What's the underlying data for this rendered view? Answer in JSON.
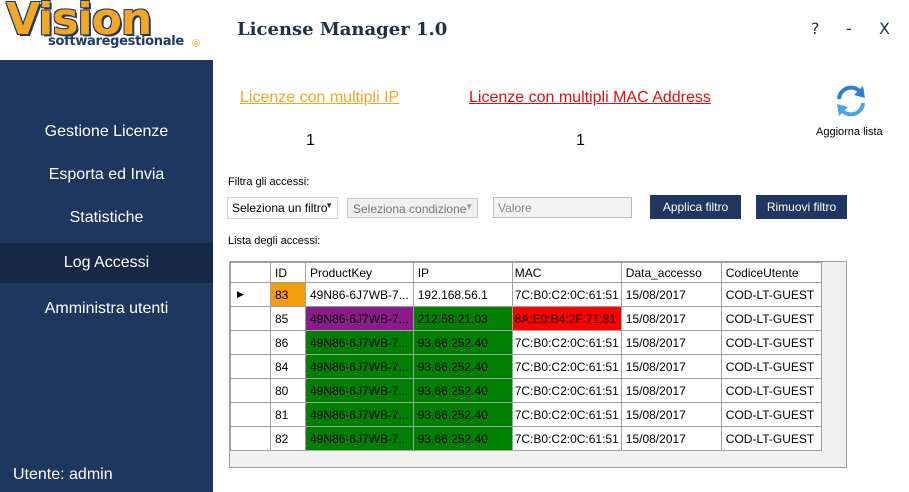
{
  "app": {
    "logo_main": "Vision",
    "logo_sub": "softwaregestionale",
    "logo_reg": "®",
    "title": "License Manager 1.0",
    "help_label": "?",
    "minimize_label": "-",
    "close_label": "X"
  },
  "sidebar": {
    "items": [
      {
        "label": "Gestione Licenze"
      },
      {
        "label": "Esporta ed Invia"
      },
      {
        "label": "Statistiche"
      },
      {
        "label": "Log Accessi"
      },
      {
        "label": "Amministra utenti"
      }
    ],
    "active_item": "Log Accessi",
    "user_label": "Utente:  admin"
  },
  "summary": {
    "multi_ip_link": "Licenze con multipli IP",
    "multi_ip_count": "1",
    "multi_mac_link": "Licenze con multipli MAC Address",
    "multi_mac_count": "1",
    "refresh_label": "Aggiorna lista",
    "refresh_icon": "refresh-arrows-icon"
  },
  "filter": {
    "label": "Filtra gli accessi:",
    "field_select": "Seleziona un filtro",
    "condition_select": "Seleziona condizione",
    "value_placeholder": "Valore",
    "apply_button": "Applica filtro",
    "remove_button": "Rimuovi filtro"
  },
  "grid": {
    "label": "Lista degli accessi:",
    "current_row_marker": "▶",
    "columns": [
      "ID",
      "ProductKey",
      "IP",
      "MAC",
      "Data_accesso",
      "CodiceUtente"
    ],
    "rows": [
      {
        "id": "83",
        "productkey": "49N86-6J7WB-7...",
        "ip": "192.168.56.1",
        "mac": "7C:B0:C2:0C:61:51",
        "date": "15/08/2017",
        "code": "COD-LT-GUEST"
      },
      {
        "id": "85",
        "productkey": "49N86-6J7WB-7...",
        "ip": "212.58.21.03",
        "mac": "8A:E0:B4:2F:71:81",
        "date": "15/08/2017",
        "code": "COD-LT-GUEST"
      },
      {
        "id": "86",
        "productkey": "49N86-6J7WB-7...",
        "ip": "93.66.252.40",
        "mac": "7C:B0:C2:0C:61:51",
        "date": "15/08/2017",
        "code": "COD-LT-GUEST"
      },
      {
        "id": "84",
        "productkey": "49N86-6J7WB-7...",
        "ip": "93.66.252.40",
        "mac": "7C:B0:C2:0C:61:51",
        "date": "15/08/2017",
        "code": "COD-LT-GUEST"
      },
      {
        "id": "80",
        "productkey": "49N86-6J7WB-7...",
        "ip": "93.66.252.40",
        "mac": "7C:B0:C2:0C:61:51",
        "date": "15/08/2017",
        "code": "COD-LT-GUEST"
      },
      {
        "id": "81",
        "productkey": "49N86-6J7WB-7...",
        "ip": "93.66.252.40",
        "mac": "7C:B0:C2:0C:61:51",
        "date": "15/08/2017",
        "code": "COD-LT-GUEST"
      },
      {
        "id": "82",
        "productkey": "49N86-6J7WB-7...",
        "ip": "93.66.252.40",
        "mac": "7C:B0:C2:0C:61:51",
        "date": "15/08/2017",
        "code": "COD-LT-GUEST"
      }
    ]
  },
  "colors": {
    "sidebar_bg": "#1f3660",
    "sidebar_active_bg": "#152848",
    "link_ip": "#f5a623",
    "link_mac": "#e01010",
    "id_highlight": "#f59d0a",
    "productkey_purple": "#8b1a8b",
    "cell_green": "#008000",
    "mac_red": "#ff0000"
  }
}
